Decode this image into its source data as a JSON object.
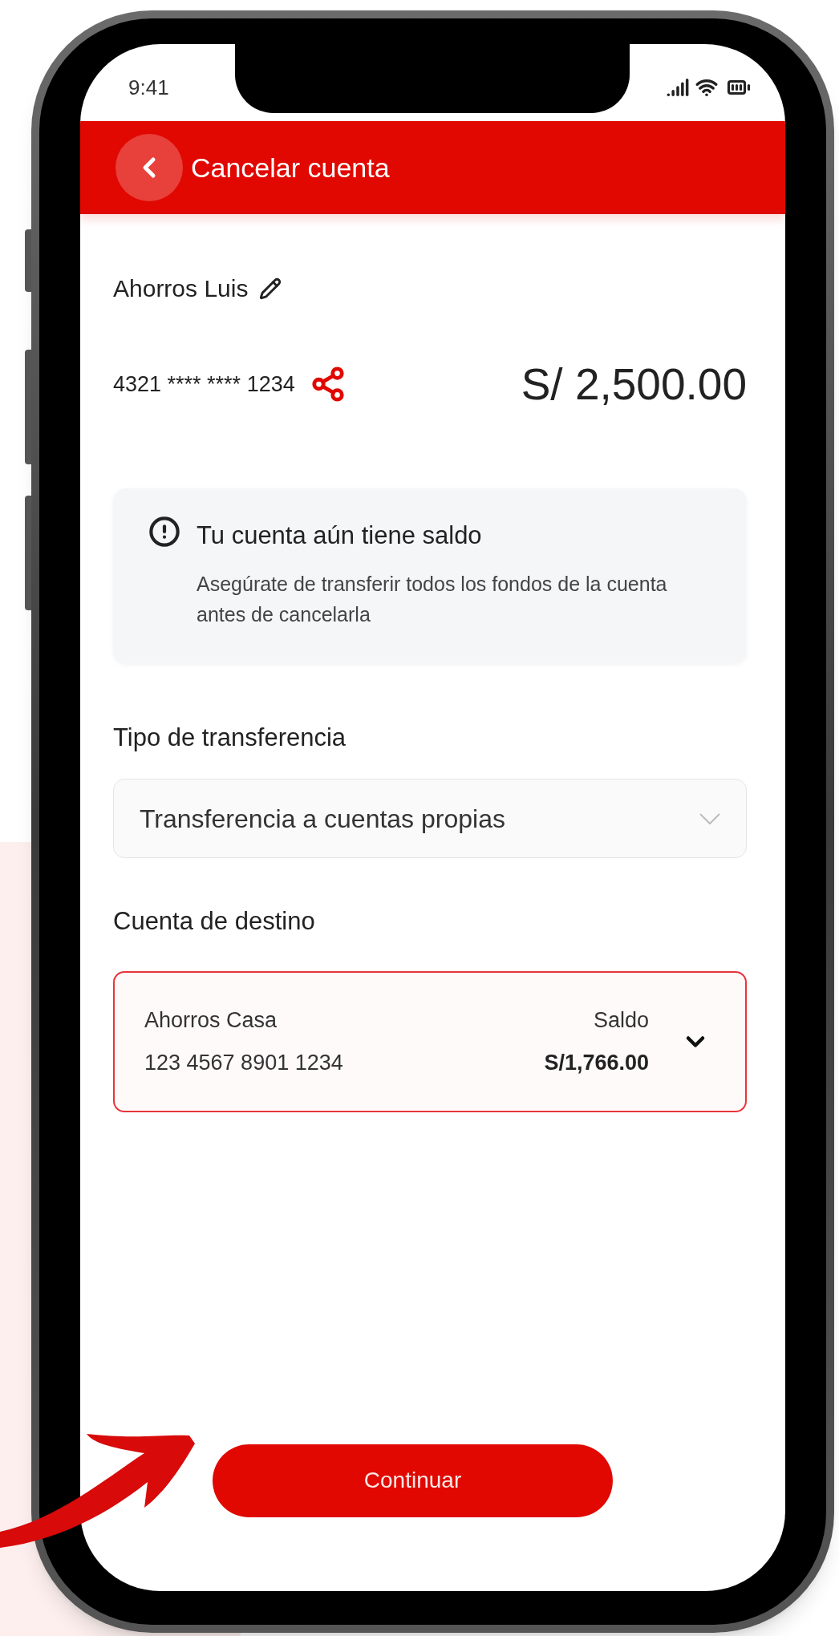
{
  "status_bar": {
    "time": "9:41"
  },
  "header": {
    "title": "Cancelar cuenta"
  },
  "account": {
    "name": "Ahorros Luis",
    "number": "4321 **** **** 1234",
    "balance": "S/ 2,500.00"
  },
  "alert": {
    "title": "Tu cuenta aún tiene saldo",
    "message": "Asegúrate de transferir todos los fondos de la cuenta antes de cancelarla"
  },
  "transfer_type": {
    "label": "Tipo de transferencia",
    "value": "Transferencia a cuentas propias"
  },
  "destination": {
    "label": "Cuenta de destino",
    "account": {
      "name": "Ahorros Casa",
      "number": "123 4567 8901 1234",
      "balance_label": "Saldo",
      "balance": "S/1,766.00"
    }
  },
  "continue_button": {
    "label": "Continuar"
  }
}
